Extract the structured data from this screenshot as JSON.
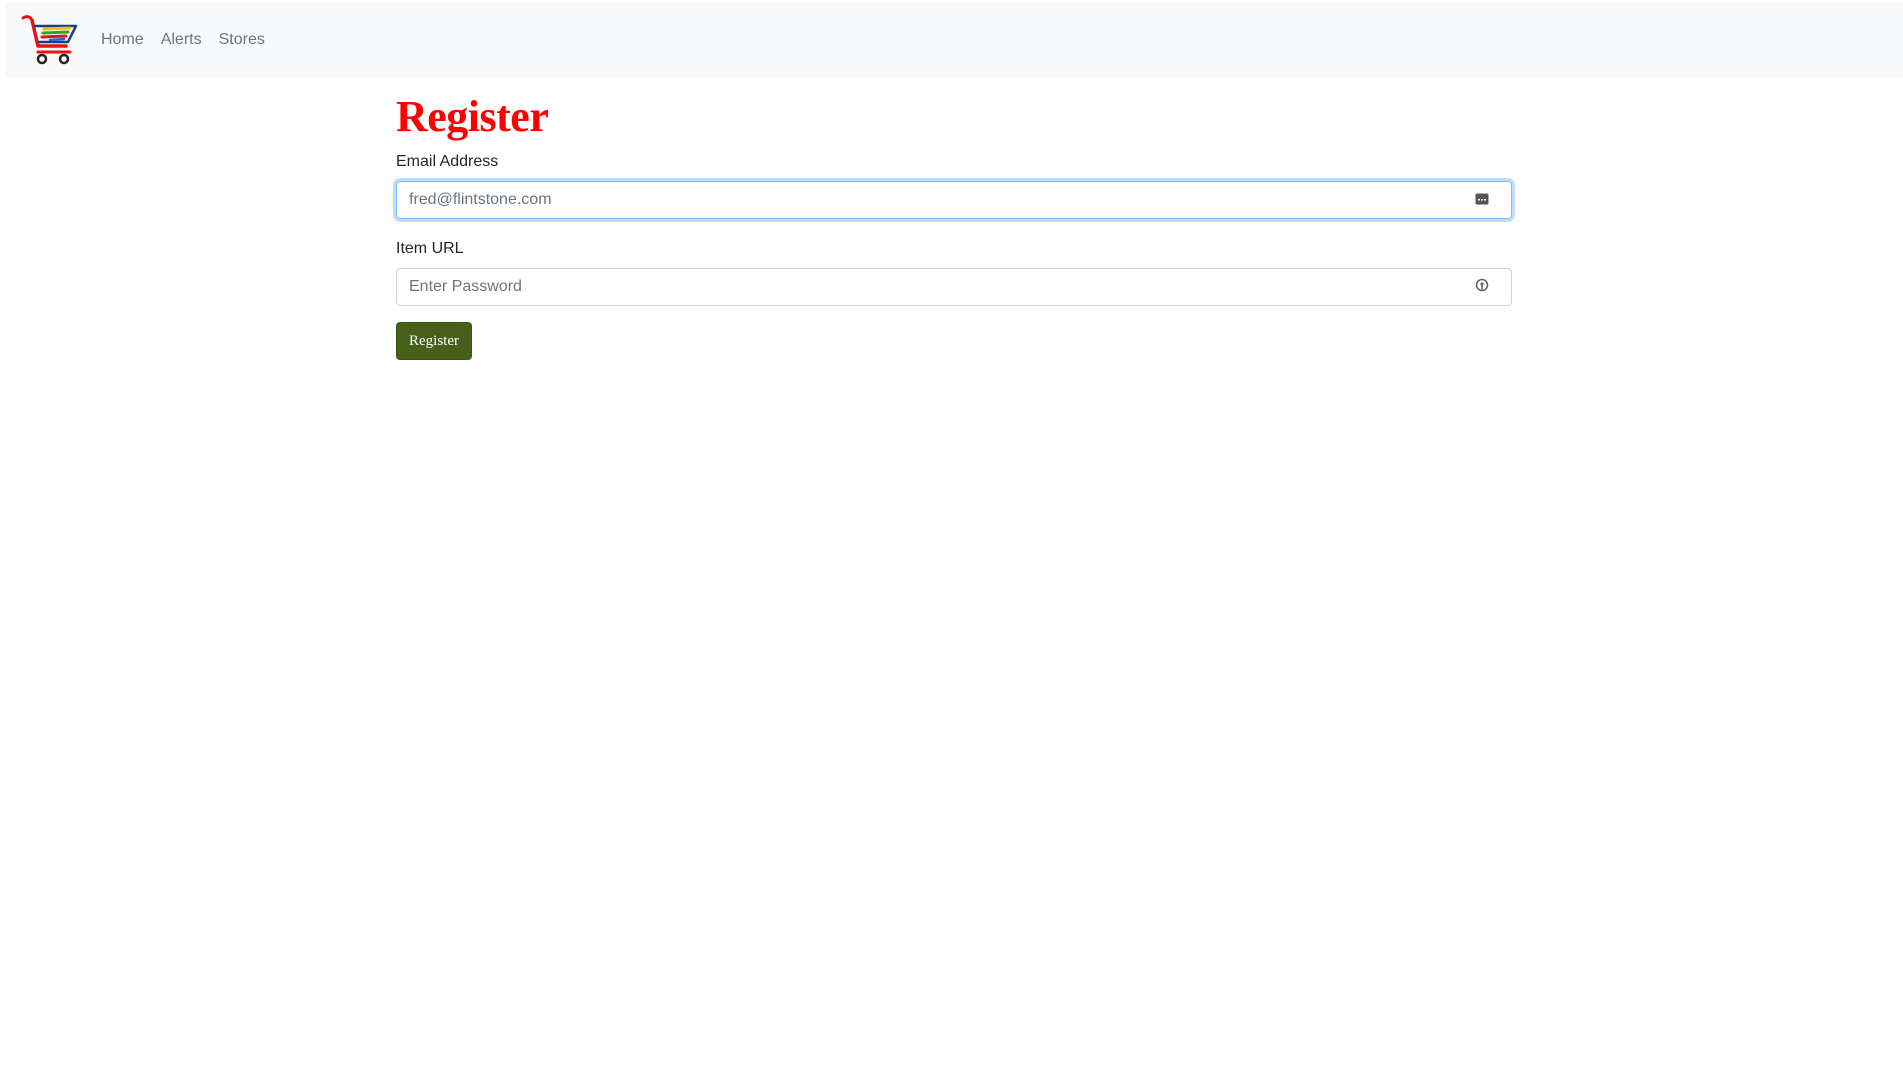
{
  "navbar": {
    "logo_alt": "shopping-cart-logo",
    "links": [
      {
        "label": "Home"
      },
      {
        "label": "Alerts"
      },
      {
        "label": "Stores"
      }
    ]
  },
  "form": {
    "title": "Register",
    "email": {
      "label": "Email Address",
      "value": "",
      "placeholder": "fred@flintstone.com",
      "icon": "autofill-card-icon"
    },
    "url": {
      "label": "Item URL",
      "value": "",
      "placeholder": "Enter Password",
      "icon": "password-key-icon"
    },
    "submit_label": "Register"
  },
  "colors": {
    "title": "#ff0000",
    "button": "#44601b",
    "navbar_bg": "#f8f9fa",
    "focus_border": "#80bdff"
  }
}
